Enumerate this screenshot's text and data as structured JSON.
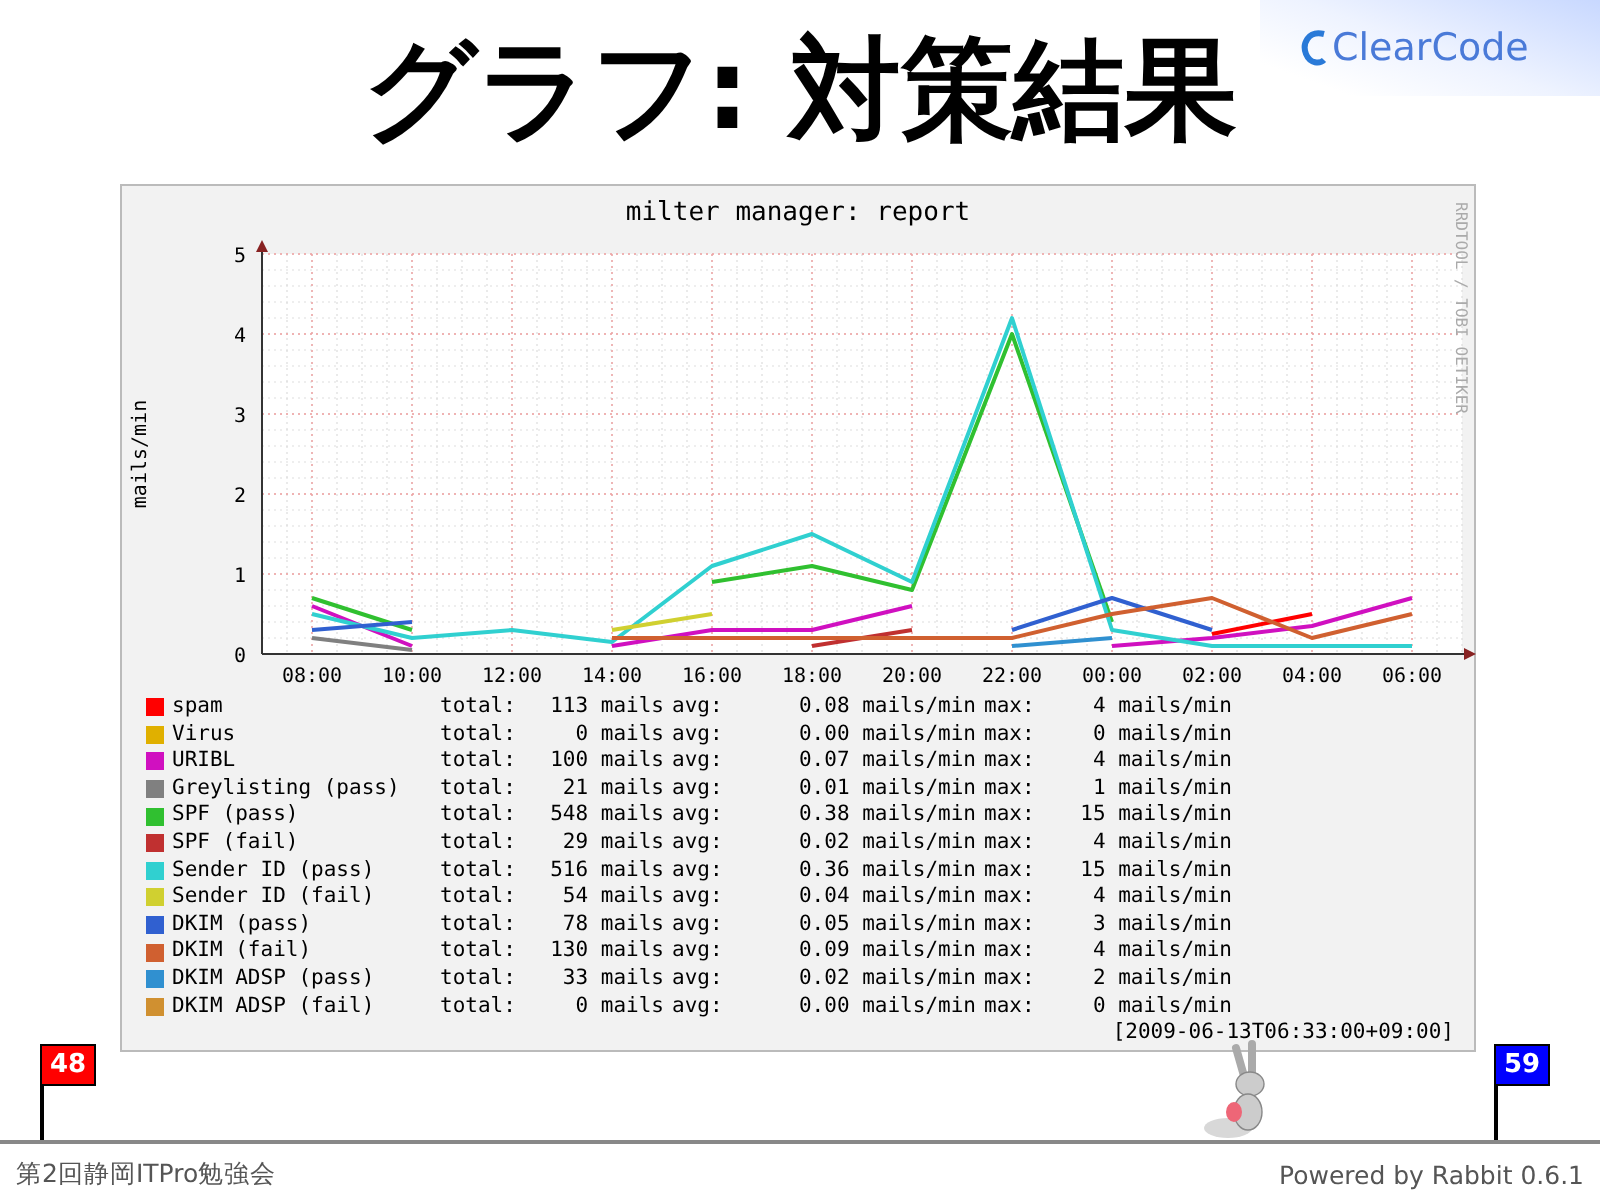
{
  "slide": {
    "title": "グラフ: 対策結果",
    "logo": "ClearCode"
  },
  "graph": {
    "chart_data": {
      "type": "line",
      "title": "milter manager: report",
      "ylabel": "mails/min",
      "grid": true,
      "categories": [
        "08:00",
        "10:00",
        "12:00",
        "14:00",
        "16:00",
        "18:00",
        "20:00",
        "22:00",
        "00:00",
        "02:00",
        "04:00",
        "06:00"
      ],
      "ylim": [
        0,
        5
      ],
      "yticks": [
        0,
        1,
        2,
        3,
        4,
        5
      ],
      "series": [
        {
          "name": "spam",
          "color": "#ff0000",
          "values": [
            null,
            null,
            null,
            null,
            null,
            null,
            null,
            null,
            null,
            0.25,
            0.5,
            null
          ]
        },
        {
          "name": "Virus",
          "color": "#e0b000",
          "values": [
            null,
            null,
            null,
            null,
            null,
            null,
            null,
            null,
            null,
            null,
            null,
            null
          ]
        },
        {
          "name": "URIBL",
          "color": "#d010c0",
          "values": [
            0.6,
            0.1,
            null,
            0.1,
            0.3,
            0.3,
            0.6,
            null,
            0.1,
            0.2,
            0.35,
            0.7
          ]
        },
        {
          "name": "Greylisting (pass)",
          "color": "#808080",
          "values": [
            0.2,
            0.05,
            null,
            null,
            null,
            null,
            null,
            null,
            null,
            null,
            null,
            null
          ]
        },
        {
          "name": "SPF (pass)",
          "color": "#30c030",
          "values": [
            0.7,
            0.3,
            null,
            null,
            0.9,
            1.1,
            0.8,
            4.0,
            0.4,
            null,
            null,
            null
          ]
        },
        {
          "name": "SPF (fail)",
          "color": "#c03030",
          "values": [
            null,
            null,
            null,
            null,
            null,
            0.1,
            0.3,
            null,
            null,
            null,
            null,
            null
          ]
        },
        {
          "name": "Sender ID (pass)",
          "color": "#30d0d0",
          "values": [
            0.5,
            0.2,
            0.3,
            0.15,
            1.1,
            1.5,
            0.9,
            4.2,
            0.3,
            0.1,
            0.1,
            0.1
          ]
        },
        {
          "name": "Sender ID (fail)",
          "color": "#d0d030",
          "values": [
            null,
            null,
            null,
            0.3,
            0.5,
            null,
            null,
            null,
            null,
            null,
            null,
            null
          ]
        },
        {
          "name": "DKIM (pass)",
          "color": "#3060d0",
          "values": [
            0.3,
            0.4,
            null,
            null,
            null,
            null,
            null,
            0.3,
            0.7,
            0.3,
            null,
            null
          ]
        },
        {
          "name": "DKIM (fail)",
          "color": "#d06030",
          "values": [
            null,
            null,
            null,
            0.2,
            0.2,
            0.2,
            0.2,
            0.2,
            0.5,
            0.7,
            0.2,
            0.5
          ]
        },
        {
          "name": "DKIM ADSP (pass)",
          "color": "#3090d0",
          "values": [
            null,
            null,
            null,
            null,
            null,
            null,
            null,
            0.1,
            0.2,
            null,
            null,
            null
          ]
        },
        {
          "name": "DKIM ADSP (fail)",
          "color": "#d09030",
          "values": [
            null,
            null,
            null,
            null,
            null,
            null,
            null,
            null,
            null,
            null,
            null,
            null
          ]
        }
      ]
    },
    "side_credit": "RRDTOOL / TOBI OETIKER",
    "legend": [
      {
        "total_label": "total:",
        "total": "113 mails",
        "avg_label": "avg:",
        "avg": "0.08 mails/min",
        "max_label": "max:",
        "max": "4 mails/min"
      },
      {
        "total_label": "total:",
        "total": "0 mails",
        "avg_label": "avg:",
        "avg": "0.00 mails/min",
        "max_label": "max:",
        "max": "0 mails/min"
      },
      {
        "total_label": "total:",
        "total": "100 mails",
        "avg_label": "avg:",
        "avg": "0.07 mails/min",
        "max_label": "max:",
        "max": "4 mails/min"
      },
      {
        "total_label": "total:",
        "total": "21 mails",
        "avg_label": "avg:",
        "avg": "0.01 mails/min",
        "max_label": "max:",
        "max": "1 mails/min"
      },
      {
        "total_label": "total:",
        "total": "548 mails",
        "avg_label": "avg:",
        "avg": "0.38 mails/min",
        "max_label": "max:",
        "max": "15 mails/min"
      },
      {
        "total_label": "total:",
        "total": "29 mails",
        "avg_label": "avg:",
        "avg": "0.02 mails/min",
        "max_label": "max:",
        "max": "4 mails/min"
      },
      {
        "total_label": "total:",
        "total": "516 mails",
        "avg_label": "avg:",
        "avg": "0.36 mails/min",
        "max_label": "max:",
        "max": "15 mails/min"
      },
      {
        "total_label": "total:",
        "total": "54 mails",
        "avg_label": "avg:",
        "avg": "0.04 mails/min",
        "max_label": "max:",
        "max": "4 mails/min"
      },
      {
        "total_label": "total:",
        "total": "78 mails",
        "avg_label": "avg:",
        "avg": "0.05 mails/min",
        "max_label": "max:",
        "max": "3 mails/min"
      },
      {
        "total_label": "total:",
        "total": "130 mails",
        "avg_label": "avg:",
        "avg": "0.09 mails/min",
        "max_label": "max:",
        "max": "4 mails/min"
      },
      {
        "total_label": "total:",
        "total": "33 mails",
        "avg_label": "avg:",
        "avg": "0.02 mails/min",
        "max_label": "max:",
        "max": "2 mails/min"
      },
      {
        "total_label": "total:",
        "total": "0 mails",
        "avg_label": "avg:",
        "avg": "0.00 mails/min",
        "max_label": "max:",
        "max": "0 mails/min"
      }
    ],
    "timestamp": "[2009-06-13T06:33:00+09:00]"
  },
  "page_markers": [
    {
      "label": "48",
      "kind": "current"
    },
    {
      "label": "59",
      "kind": "total"
    }
  ],
  "footer": {
    "event": "第2回静岡ITPro勉強会",
    "credit": "Powered by Rabbit 0.6.1"
  }
}
